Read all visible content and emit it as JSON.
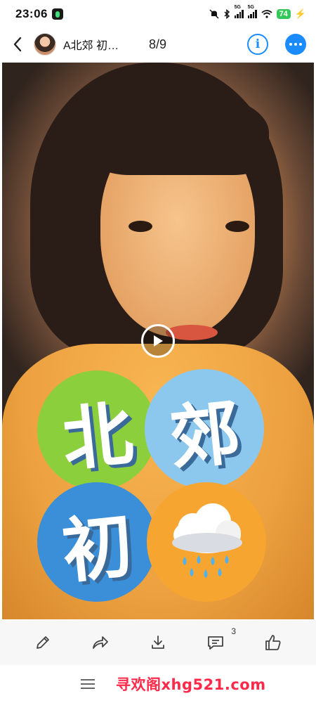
{
  "status_bar": {
    "time": "23:06",
    "network_1": "5G",
    "network_2": "5G",
    "battery": "74"
  },
  "header": {
    "back_icon": "chevron-left-icon",
    "title": "A北郊 初…",
    "counter": "8/9",
    "info_icon": "info-icon",
    "more_icon": "more-icon",
    "accent_color": "#1a8cff"
  },
  "media": {
    "play_icon": "play-icon",
    "stickers": [
      "北",
      "郊",
      "初"
    ],
    "weather_sticker": "rain-cloud-icon",
    "sticker_colors": [
      "#8ccf3c",
      "#8cc8ee",
      "#3b8fd8",
      "#f6a531"
    ]
  },
  "action_bar": {
    "items": [
      {
        "icon": "edit-icon"
      },
      {
        "icon": "share-icon"
      },
      {
        "icon": "download-icon"
      },
      {
        "icon": "comment-icon",
        "count": "3"
      },
      {
        "icon": "like-icon"
      }
    ]
  },
  "nav_bar": {
    "menu_icon": "menu-icon",
    "watermark": "寻欢阁xhg521.com",
    "watermark_color": "#ff2a4a"
  }
}
